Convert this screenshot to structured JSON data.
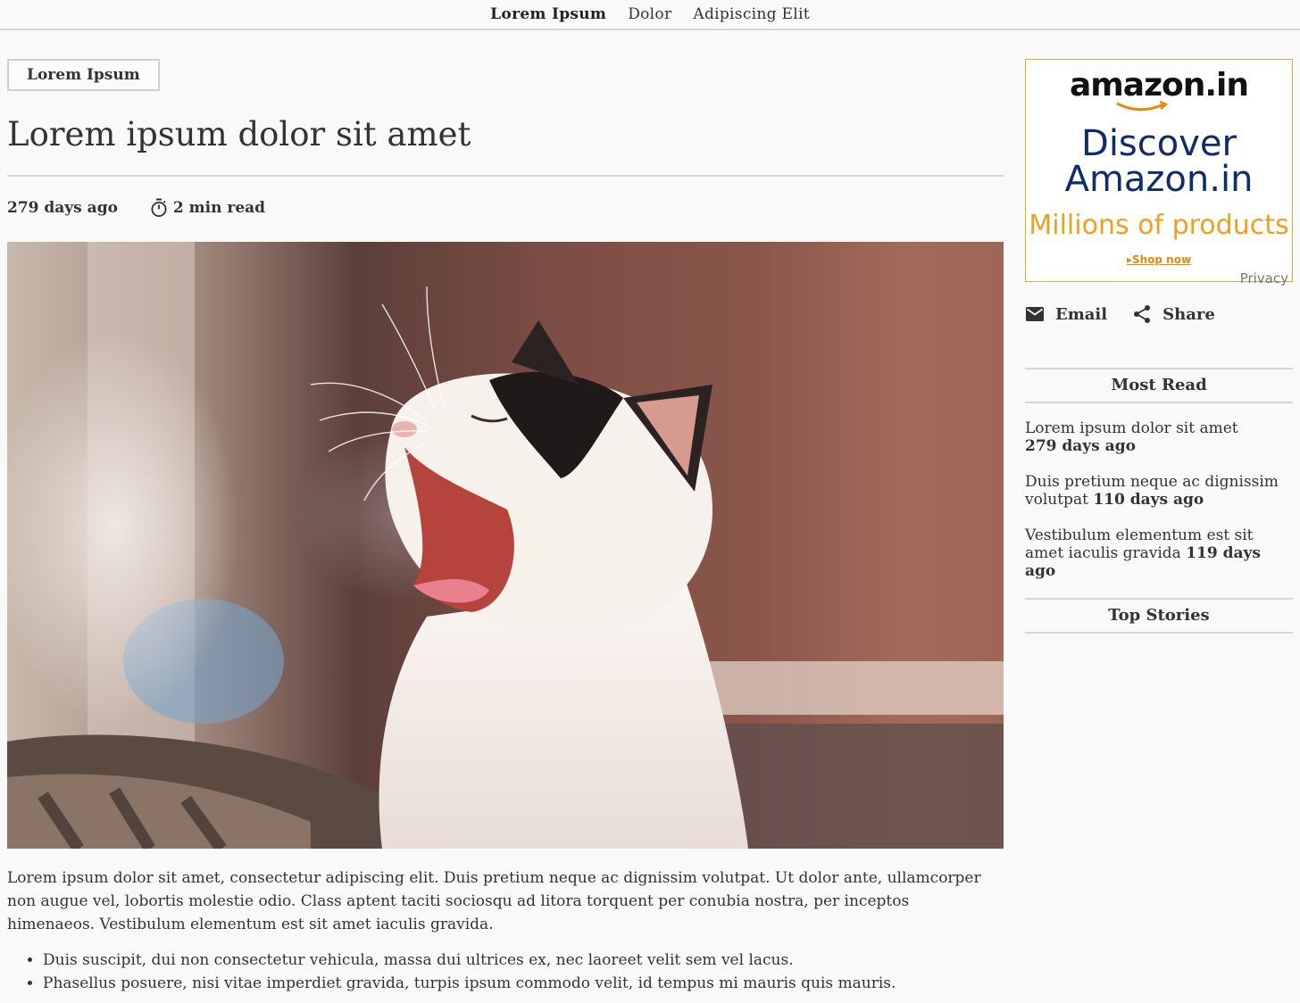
{
  "nav": {
    "items": [
      {
        "label": "Lorem Ipsum",
        "active": true
      },
      {
        "label": "Dolor",
        "active": false
      },
      {
        "label": "Adipiscing Elit",
        "active": false
      }
    ]
  },
  "article": {
    "category": "Lorem Ipsum",
    "title": "Lorem ipsum dolor sit amet",
    "posted": "279 days ago",
    "read_time": "2 min read",
    "read_time_icon": "stopwatch-icon",
    "image_subject": "yawning-kitten-photo",
    "paragraph": "Lorem ipsum dolor sit amet, consectetur adipiscing elit. Duis pretium neque ac dignissim volutpat. Ut dolor ante, ullamcorper non augue vel, lobortis molestie odio. Class aptent taciti sociosqu ad litora torquent per conubia nostra, per inceptos himenaeos. Vestibulum elementum est sit amet iaculis gravida.",
    "bullets": [
      "Duis suscipit, dui non consectetur vehicula, massa dui ultrices ex, nec laoreet velit sem vel lacus.",
      "Phasellus posuere, nisi vitae imperdiet gravida, turpis ipsum commodo velit, id tempus mi mauris quis mauris."
    ]
  },
  "ad": {
    "logo": "amazon.in",
    "headline_line1": "Discover",
    "headline_line2": "Amazon.in",
    "tagline": "Millions of products",
    "cta": "Shop now",
    "privacy": "Privacy",
    "colors": {
      "border": "#e6a53b",
      "headline": "#0f2d6b",
      "tagline": "#f0a020",
      "cta": "#e8890a"
    }
  },
  "share": {
    "email_label": "Email",
    "email_icon": "envelope-icon",
    "share_label": "Share",
    "share_icon": "share-icon"
  },
  "most_read": {
    "heading": "Most Read",
    "items": [
      {
        "title": "Lorem ipsum dolor sit amet",
        "when": "279 days ago"
      },
      {
        "title": "Duis pretium neque ac dignissim volutpat",
        "when": "110 days ago"
      },
      {
        "title": "Vestibulum elementum est sit amet iaculis gravida",
        "when": "119 days ago"
      }
    ]
  },
  "top_stories": {
    "heading": "Top Stories"
  }
}
